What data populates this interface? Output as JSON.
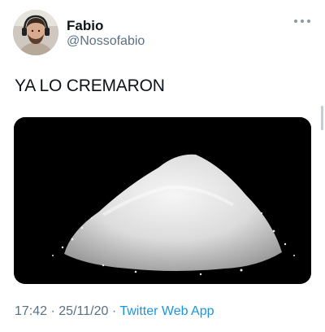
{
  "author": {
    "display_name": "Fabio",
    "handle": "@Nossofabio",
    "avatar_icon": "profile-photo"
  },
  "tweet": {
    "text": "YA LO CREMARON",
    "media_description_icon": "powder-pile-image",
    "time": "17:42",
    "separator": "·",
    "date": "25/11/20",
    "source": "Twitter Web App"
  },
  "menu": {
    "icon": "more-options-icon"
  },
  "colors": {
    "text": "#0f1419",
    "secondary": "#5b7083",
    "link": "#1b95e0",
    "media_background": "#000000"
  }
}
